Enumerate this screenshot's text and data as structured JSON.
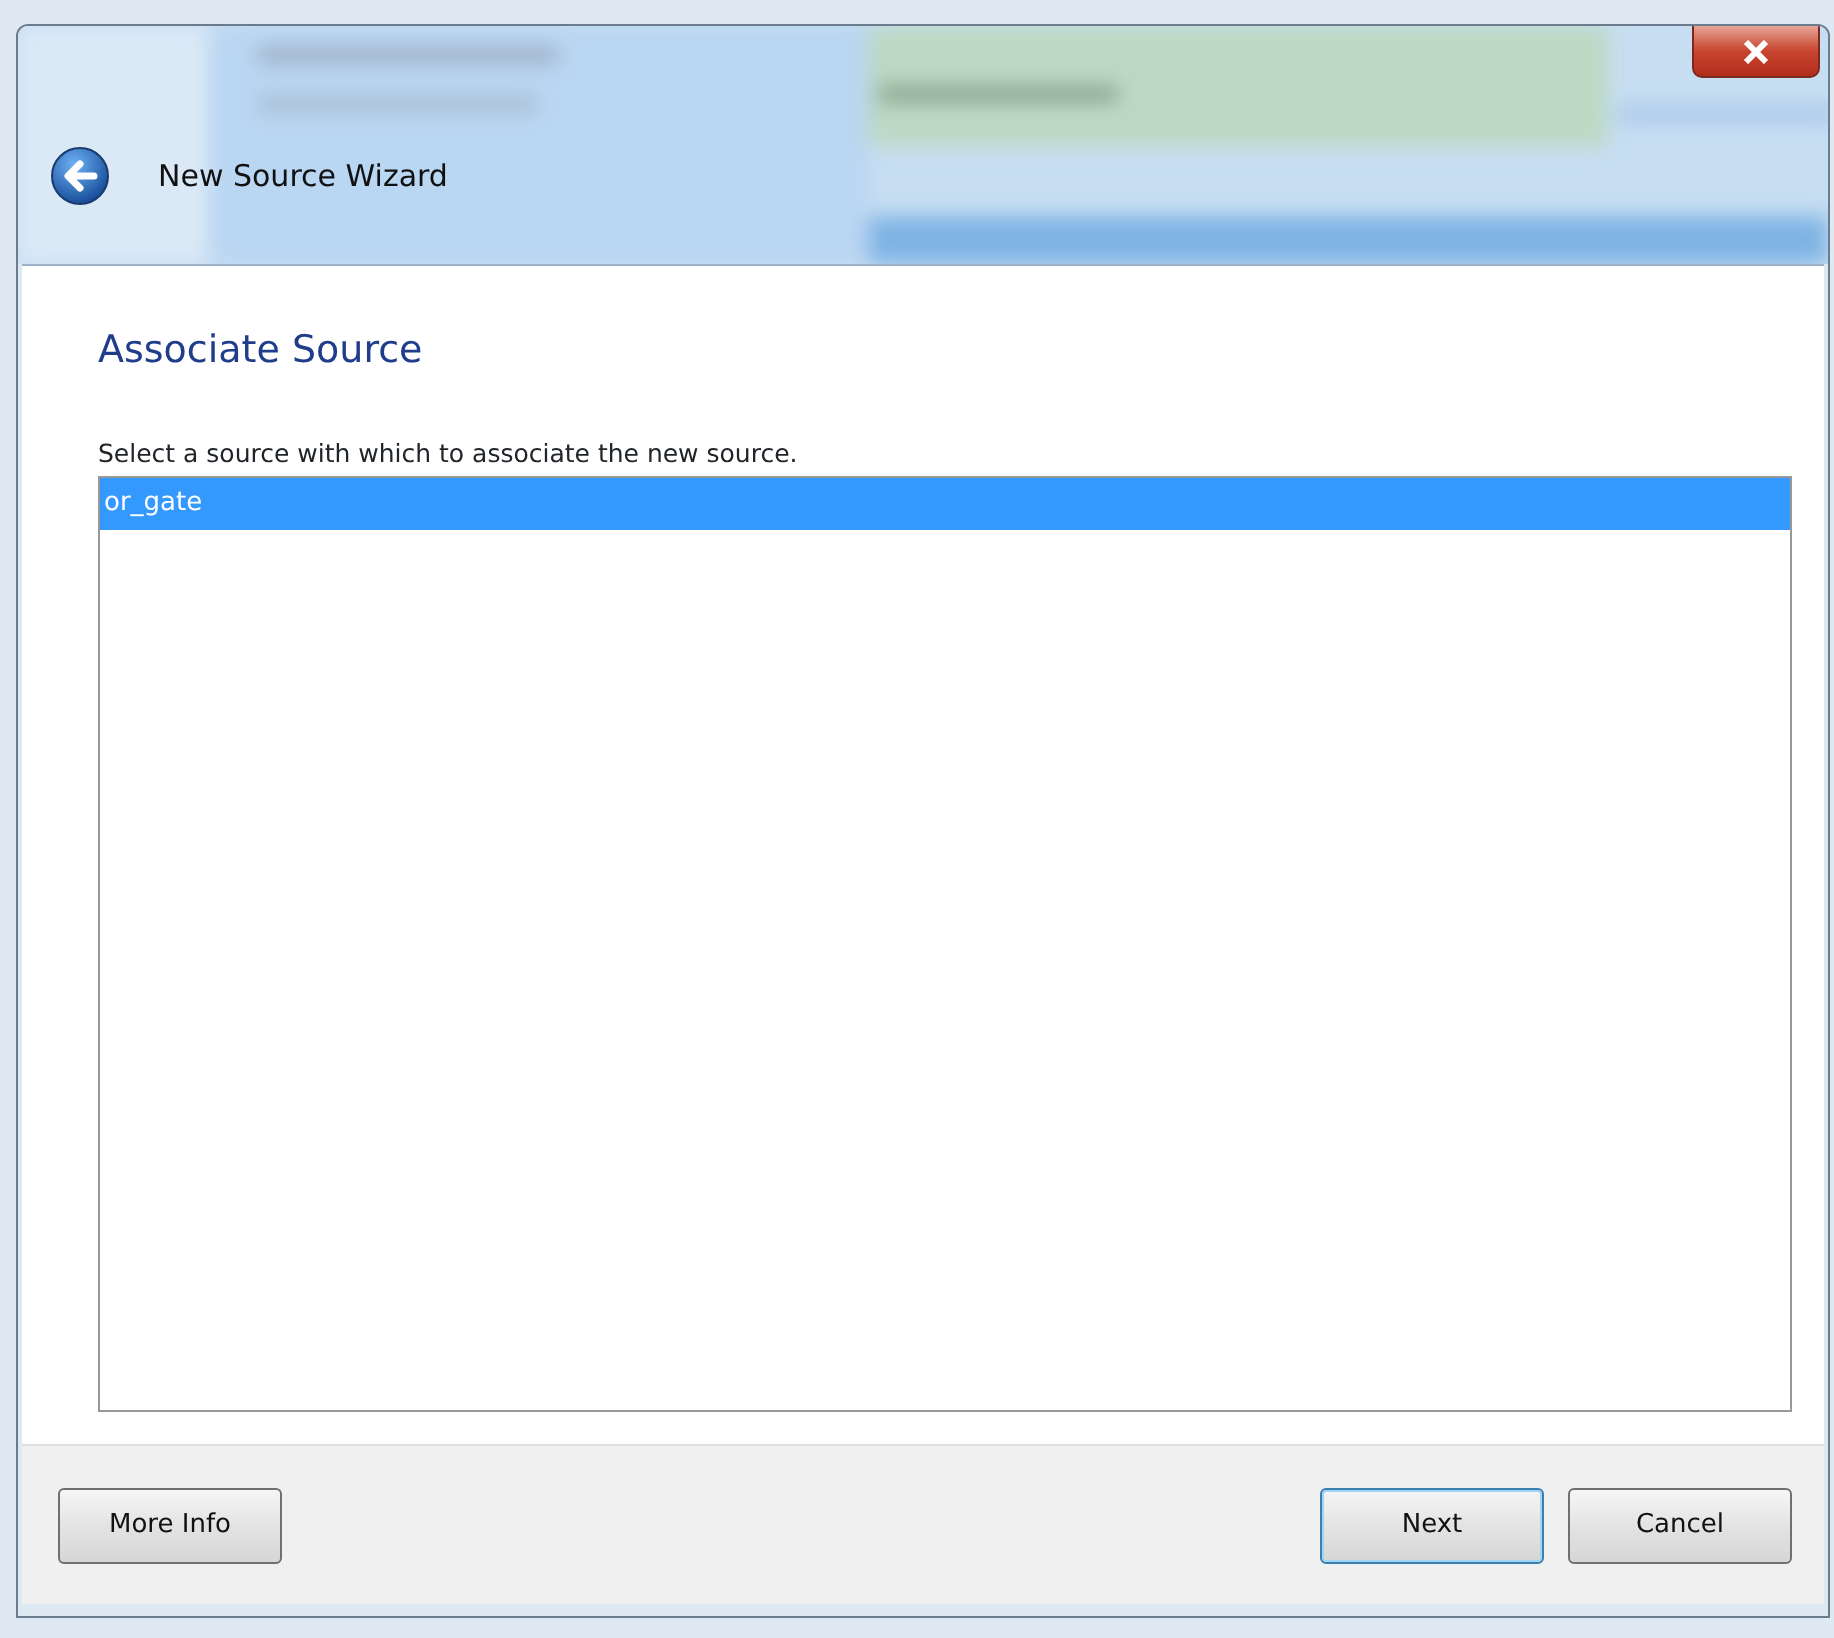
{
  "window": {
    "title": "New Source Wizard"
  },
  "page": {
    "heading": "Associate Source",
    "instruction": "Select a source with which to associate the new source."
  },
  "sources": [
    {
      "label": "or_gate",
      "selected": true
    }
  ],
  "buttons": [
    {
      "label": "More Info",
      "default": false,
      "kind": "help"
    },
    {
      "label": "Next",
      "default": true,
      "kind": "command"
    },
    {
      "label": "Cancel",
      "default": false,
      "kind": "command"
    }
  ]
}
